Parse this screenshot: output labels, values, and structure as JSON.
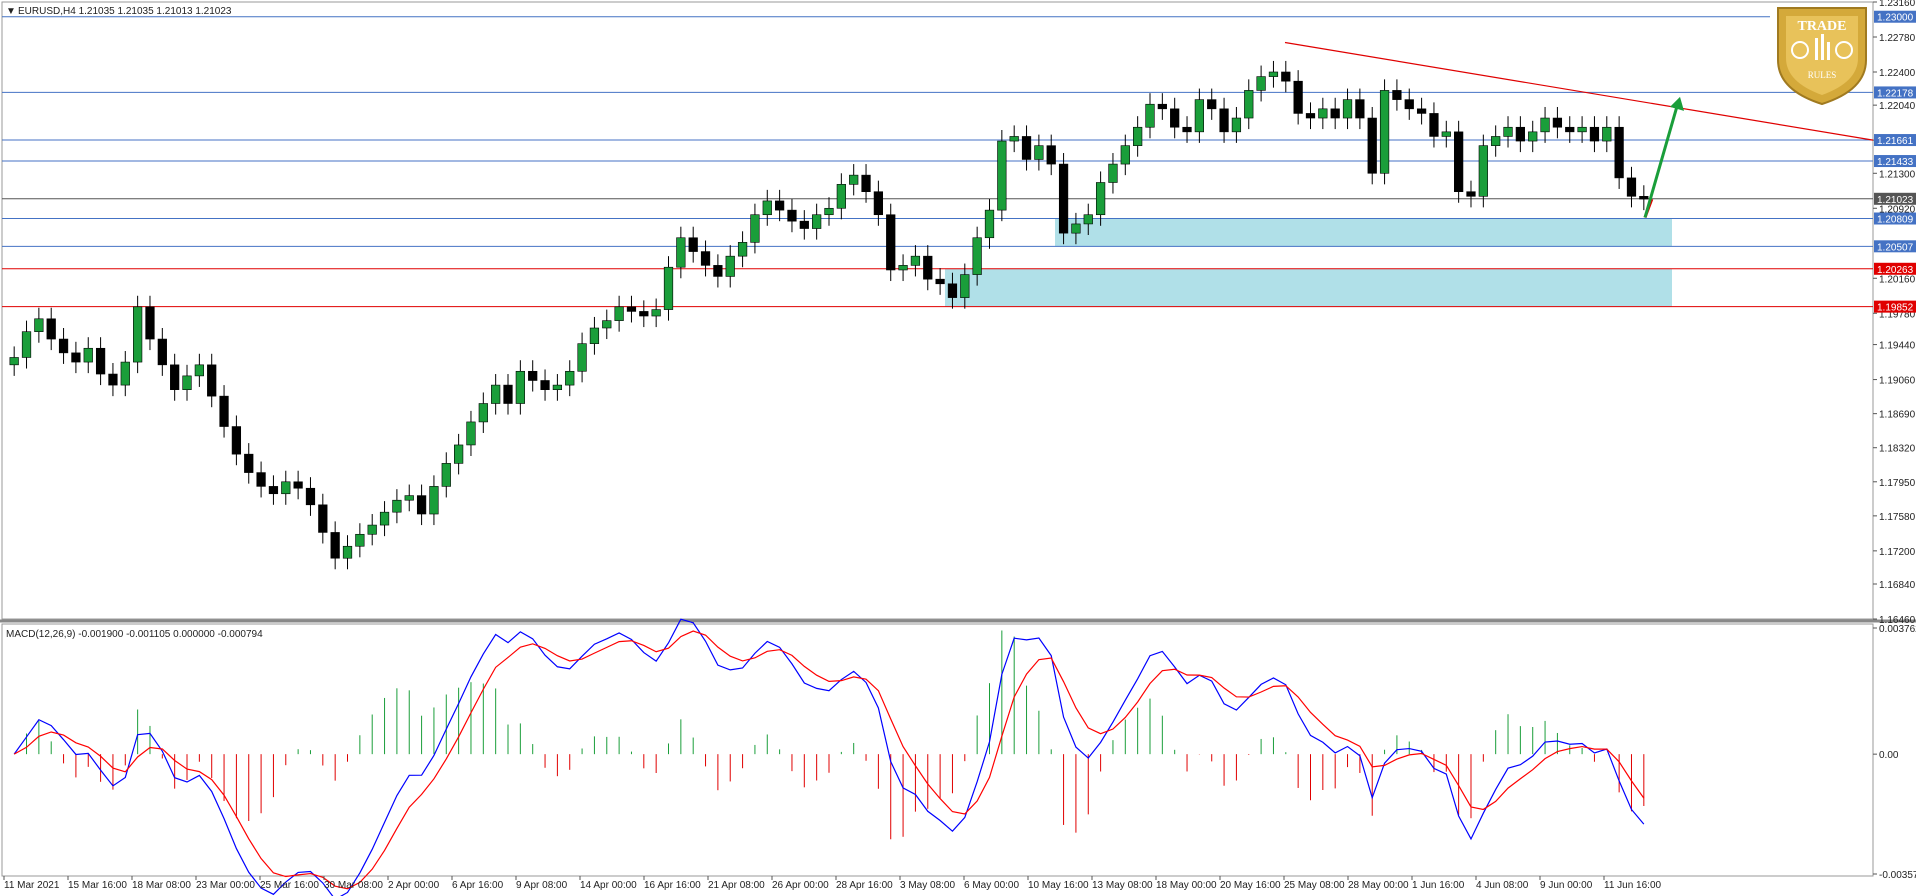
{
  "header": {
    "symbol_info": "EURUSD,H4  1.21035 1.21035 1.21013 1.21023",
    "macd_info": "MACD(12,26,9) -0.001900 -0.001105 0.000000 -0.000794"
  },
  "logo": {
    "top_text": "TRADE",
    "bottom_text": "RULES",
    "color": "#d4a93a"
  },
  "chart_data": [
    {
      "type": "candlestick",
      "title": "EURUSD,H4",
      "ylim": [
        1.1646,
        1.2316
      ],
      "y_ticks": [
        "1.23160",
        "1.22780",
        "1.22400",
        "1.22040",
        "1.21660",
        "1.21300",
        "1.20920",
        "1.20160",
        "1.19780",
        "1.19440",
        "1.19060",
        "1.18690",
        "1.18320",
        "1.17950",
        "1.17580",
        "1.17200",
        "1.16840",
        "1.16460"
      ],
      "x_ticks": [
        "11 Mar 2021",
        "15 Mar 16:00",
        "18 Mar 08:00",
        "23 Mar 00:00",
        "25 Mar 16:00",
        "30 Mar 08:00",
        "2 Apr 00:00",
        "6 Apr 16:00",
        "9 Apr 08:00",
        "14 Apr 00:00",
        "16 Apr 16:00",
        "21 Apr 08:00",
        "26 Apr 00:00",
        "28 Apr 16:00",
        "3 May 08:00",
        "6 May 00:00",
        "10 May 16:00",
        "13 May 08:00",
        "18 May 00:00",
        "20 May 16:00",
        "25 May 08:00",
        "28 May 00:00",
        "1 Jun 16:00",
        "4 Jun 08:00",
        "9 Jun 00:00",
        "11 Jun 16:00"
      ],
      "close_series": [
        1.193,
        1.1958,
        1.1972,
        1.195,
        1.1935,
        1.1925,
        1.194,
        1.1912,
        1.19,
        1.1925,
        1.1985,
        1.195,
        1.1922,
        1.1895,
        1.191,
        1.1922,
        1.1888,
        1.1855,
        1.1825,
        1.1805,
        1.179,
        1.1782,
        1.1795,
        1.1788,
        1.177,
        1.174,
        1.1712,
        1.1725,
        1.1738,
        1.1748,
        1.1762,
        1.1775,
        1.178,
        1.176,
        1.179,
        1.1815,
        1.1835,
        1.186,
        1.188,
        1.19,
        1.188,
        1.1915,
        1.1905,
        1.1895,
        1.19,
        1.1915,
        1.1945,
        1.1962,
        1.197,
        1.1985,
        1.198,
        1.1975,
        1.1982,
        1.2028,
        1.206,
        1.2045,
        1.203,
        1.2018,
        1.204,
        1.2055,
        1.2085,
        1.21,
        1.209,
        1.2078,
        1.207,
        1.2085,
        1.2092,
        1.2118,
        1.2128,
        1.211,
        1.2085,
        1.2025,
        1.203,
        1.204,
        1.2015,
        1.201,
        1.1995,
        1.202,
        1.206,
        1.209,
        1.2165,
        1.217,
        1.2145,
        1.216,
        1.214,
        1.2065,
        1.2075,
        1.2085,
        1.212,
        1.214,
        1.216,
        1.218,
        1.2205,
        1.22,
        1.218,
        1.2175,
        1.221,
        1.22,
        1.2175,
        1.219,
        1.222,
        1.2235,
        1.224,
        1.223,
        1.2195,
        1.219,
        1.22,
        1.219,
        1.221,
        1.219,
        1.213,
        1.222,
        1.221,
        1.22,
        1.2195,
        1.217,
        1.2175,
        1.211,
        1.2105,
        1.216,
        1.217,
        1.218,
        1.2165,
        1.2175,
        1.219,
        1.218,
        1.2175,
        1.218,
        1.2165,
        1.218,
        1.2125,
        1.2105,
        1.2102
      ],
      "horizontal_levels": [
        {
          "label": "1.23000",
          "color": "#4472c4"
        },
        {
          "label": "1.22178",
          "color": "#4472c4"
        },
        {
          "label": "1.21661",
          "color": "#4472c4"
        },
        {
          "label": "1.21433",
          "color": "#4472c4"
        },
        {
          "label": "1.21023",
          "color": "#555555"
        },
        {
          "label": "1.20809",
          "color": "#4472c4"
        },
        {
          "label": "1.20507",
          "color": "#4472c4"
        },
        {
          "label": "1.20263",
          "color": "#e00000"
        },
        {
          "label": "1.19852",
          "color": "#e00000"
        }
      ],
      "zones": [
        {
          "from": 1.20507,
          "to": 1.20809,
          "color": "#b0e0e8"
        },
        {
          "from": 1.19852,
          "to": 1.20263,
          "color": "#b0e0e8"
        }
      ],
      "trendline": {
        "from_price": 1.2272,
        "to_price": 1.2166,
        "color": "#e00000"
      },
      "projection": {
        "down_to": 1.2082,
        "up_to": 1.2213,
        "down_color": "#e00000",
        "up_color": "#1a9e3a"
      }
    },
    {
      "type": "macd",
      "title": "MACD(12,26,9)",
      "ylim": [
        -0.003574,
        0.003762
      ],
      "y_ticks": [
        "0.003762",
        "0.00",
        "-0.003574"
      ],
      "macd_color": "#0000ff",
      "signal_color": "#ff0000",
      "hist_pos_color": "#1a9e3a",
      "hist_neg_color": "#e00000"
    }
  ]
}
